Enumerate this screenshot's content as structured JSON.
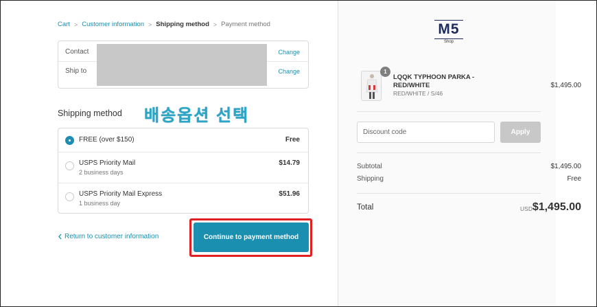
{
  "breadcrumb": {
    "cart": "Cart",
    "customer_information": "Customer information",
    "shipping_method": "Shipping method",
    "payment_method": "Payment method",
    "separator": ">"
  },
  "info": {
    "contact_label": "Contact",
    "ship_to_label": "Ship to",
    "change_label": "Change"
  },
  "shipping": {
    "title": "Shipping method",
    "annotation": "배송옵션 선택",
    "options": [
      {
        "name": "FREE (over $150)",
        "sub": "",
        "price": "Free",
        "selected": true
      },
      {
        "name": "USPS Priority Mail",
        "sub": "2 business days",
        "price": "$14.79",
        "selected": false
      },
      {
        "name": "USPS Priority Mail Express",
        "sub": "1 business day",
        "price": "$51.96",
        "selected": false
      }
    ]
  },
  "actions": {
    "return_label": "Return to customer information",
    "continue_label": "Continue to payment method"
  },
  "logo": {
    "main": "M5",
    "sub": "Shop"
  },
  "product": {
    "name": "LQQK TYPHOON PARKA - RED/WHITE",
    "variant": "RED/WHITE / S/46",
    "price": "$1,495.00",
    "quantity": "1"
  },
  "discount": {
    "placeholder": "Discount code",
    "apply_label": "Apply"
  },
  "summary": {
    "subtotal_label": "Subtotal",
    "subtotal_value": "$1,495.00",
    "shipping_label": "Shipping",
    "shipping_value": "Free",
    "total_label": "Total",
    "currency": "USD",
    "total_value": "$1,495.00"
  },
  "colors": {
    "accent": "#1a8fb0",
    "highlight": "#e02020",
    "annotation": "#2aa6c8"
  }
}
